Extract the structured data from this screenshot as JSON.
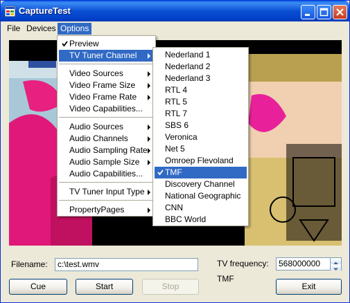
{
  "window": {
    "title": "CaptureTest"
  },
  "menubar": {
    "items": [
      "File",
      "Devices",
      "Options"
    ]
  },
  "options_menu": {
    "items": [
      {
        "label": "Preview",
        "checked": true
      },
      {
        "label": "TV Tuner Channel",
        "submenu": true,
        "highlighted": true
      },
      {
        "label": "Video Sources",
        "submenu": true
      },
      {
        "label": "Video Frame Size",
        "submenu": true
      },
      {
        "label": "Video Frame Rate",
        "submenu": true
      },
      {
        "label": "Video Capabilities..."
      },
      {
        "label": "Audio Sources",
        "submenu": true
      },
      {
        "label": "Audio Channels",
        "submenu": true
      },
      {
        "label": "Audio Sampling Rate",
        "submenu": true
      },
      {
        "label": "Audio Sample Size",
        "submenu": true
      },
      {
        "label": "Audio Capabilities..."
      },
      {
        "label": "TV Tuner Input Type",
        "submenu": true
      },
      {
        "label": "PropertyPages",
        "submenu": true
      }
    ]
  },
  "channel_menu": {
    "items": [
      "Nederland 1",
      "Nederland 2",
      "Nederland 3",
      "RTL 4",
      "RTL 5",
      "RTL 7",
      "SBS 6",
      "Veronica",
      "Net 5",
      "Omroep Flevoland",
      "TMF",
      "Discovery Channel",
      "National Geographic",
      "CNN",
      "BBC World"
    ],
    "selected": "TMF"
  },
  "controls": {
    "filename_label": "Filename:",
    "filename_value": "c:\\test.wmv",
    "tv_frequency_label": "TV frequency:",
    "tv_frequency_value": "568000000",
    "channel_status": "TMF",
    "cue_label": "Cue",
    "start_label": "Start",
    "stop_label": "Stop",
    "exit_label": "Exit"
  },
  "colors": {
    "titlebar": "#0a4fd3",
    "highlight": "#316ac5",
    "window_bg": "#ece9d8"
  }
}
